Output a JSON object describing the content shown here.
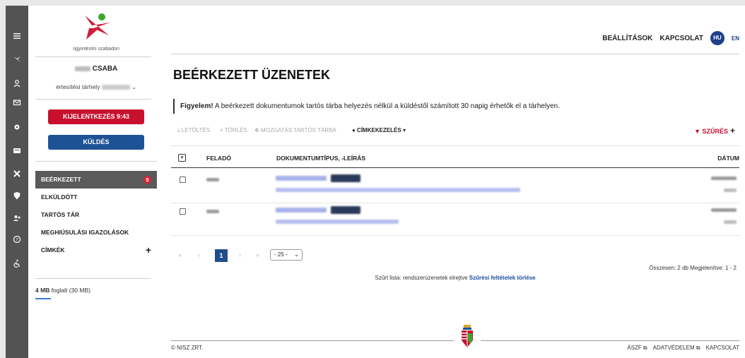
{
  "logo": {
    "text": "ügyintézés szabadon"
  },
  "user": {
    "name": "CSABA",
    "storage_label": "értesítési tárhely"
  },
  "buttons": {
    "logout": "KIJELENTKEZÉS 9:43",
    "send": "KÜLDÉS"
  },
  "nav": {
    "items": [
      {
        "label": "BEÉRKEZETT",
        "badge": "5"
      },
      {
        "label": "ELKÜLDÖTT"
      },
      {
        "label": "TARTÓS TÁR"
      },
      {
        "label": "MEGHIÚSULÁSI IGAZOLÁSOK"
      },
      {
        "label": "CÍMKÉK",
        "action": "+"
      }
    ]
  },
  "quota": {
    "used": "4 MB",
    "rest": "foglalt (30 MB)",
    "fraction": 0.13
  },
  "topbar": {
    "settings": "BEÁLLÍTÁSOK",
    "contact": "KAPCSOLAT",
    "lang_hu": "HU",
    "lang_en": "EN"
  },
  "page": {
    "title": "BEÉRKEZETT ÜZENETEK"
  },
  "notice": {
    "strong": "Figyelem!",
    "text": " A beérkezett dokumentumok tartós tárba helyezés nélkül a küldéstől számított 30 napig érhetők el a tárhelyen."
  },
  "toolbar": {
    "download": "⤓ LETÖLTÉS",
    "delete": "× TÖRLÉS",
    "move": "✥ MOZGATÁS TARTÓS TÁRBA",
    "tags": "● CÍMKEKEZELÉS ▾",
    "filter": "▼ SZŰRÉS",
    "filter_plus": "+"
  },
  "table": {
    "headers": {
      "sender": "FELADÓ",
      "doctype": "DOKUMENTUMTÍPUS, -LEÍRÁS",
      "date": "DÁTUM"
    }
  },
  "pager": {
    "first": "«",
    "prev": "‹",
    "current": "1",
    "next": "›",
    "last": "»",
    "page_size": "- 25 -"
  },
  "summary": {
    "total": "Összesen: 2 db  Megjelenítve: 1 - 2"
  },
  "filter_note": {
    "text": "Szűrt lista: rendszerüzenetek elrejtve",
    "link": "Szűrési feltételek törlése"
  },
  "footer": {
    "copyright": "© NISZ ZRT.",
    "aszf": "ÁSZF ⧉",
    "privacy": "ADATVÉDELEM ⧉",
    "contact": "KAPCSOLAT"
  },
  "colors": {
    "rail": "#535353",
    "logout": "#c8102e",
    "send": "#1e5296",
    "active_nav": "#5a5a5a",
    "link": "#1a4fa0"
  }
}
